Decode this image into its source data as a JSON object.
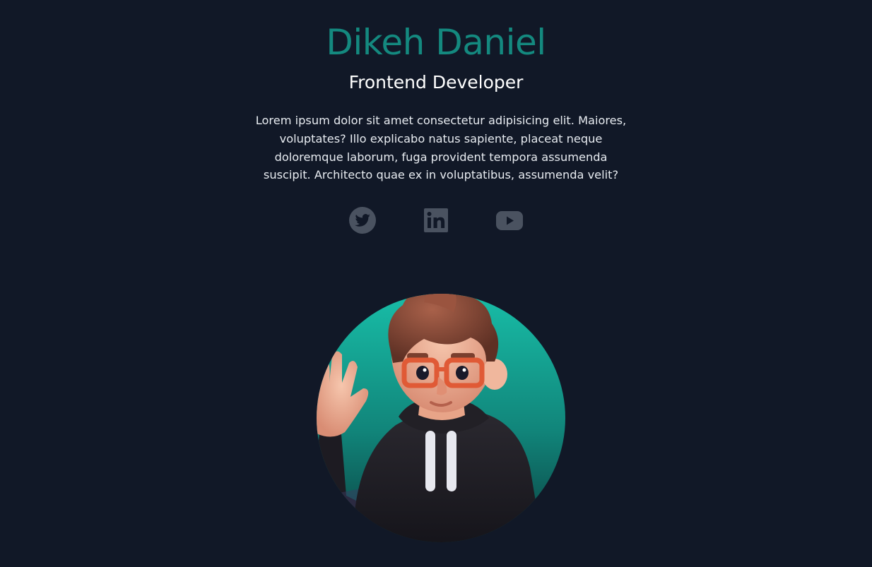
{
  "profile": {
    "name": "Dikeh Daniel",
    "role": "Frontend Developer",
    "bio": "Lorem ipsum dolor sit amet consectetur adipisicing elit. Maiores, voluptates? Illo explicabo natus sapiente, placeat neque doloremque laborum, fuga provident tempora assumenda suscipit. Architecto quae ex in voluptatibus, assumenda velit?"
  },
  "socials": [
    {
      "icon": "twitter-icon"
    },
    {
      "icon": "linkedin-icon"
    },
    {
      "icon": "youtube-icon"
    }
  ],
  "colors": {
    "background": "#111827",
    "accent": "#14897f",
    "icon": "#4a5260",
    "avatar_gradient_top": "#14b8a6",
    "avatar_gradient_bottom": "#0e5c57"
  }
}
